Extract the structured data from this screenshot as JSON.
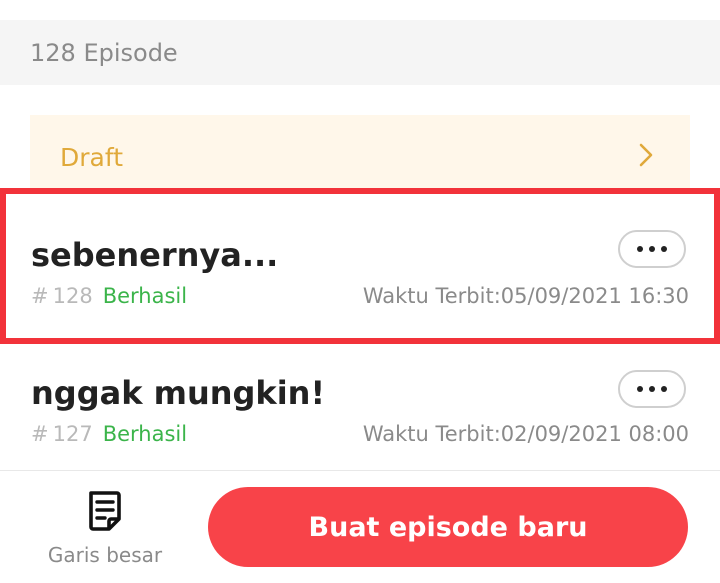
{
  "episode_count": "128 Episode",
  "draft": {
    "label": "Draft",
    "chevron_icon": "chevron-right-icon"
  },
  "episodes": [
    {
      "title": "sebenernya...",
      "hash": "#",
      "number": "128",
      "status": "Berhasil",
      "publish": "Waktu Terbit:05/09/2021 16:30",
      "highlighted": true,
      "more_icon": "more-dots-icon"
    },
    {
      "title": "nggak mungkin!",
      "hash": "#",
      "number": "127",
      "status": "Berhasil",
      "publish": "Waktu Terbit:02/09/2021 08:00",
      "highlighted": false,
      "more_icon": "more-dots-icon"
    }
  ],
  "bottom_bar": {
    "outline_label": "Garis besar",
    "outline_icon": "outline-document-icon",
    "create_label": "Buat episode baru"
  },
  "colors": {
    "accent_red": "#f84349",
    "highlight_border": "#f2323a",
    "draft_text": "#e0a93a",
    "draft_bg": "#fff7ea",
    "status_green": "#3bb44a",
    "muted_text": "#8a8a8a"
  }
}
